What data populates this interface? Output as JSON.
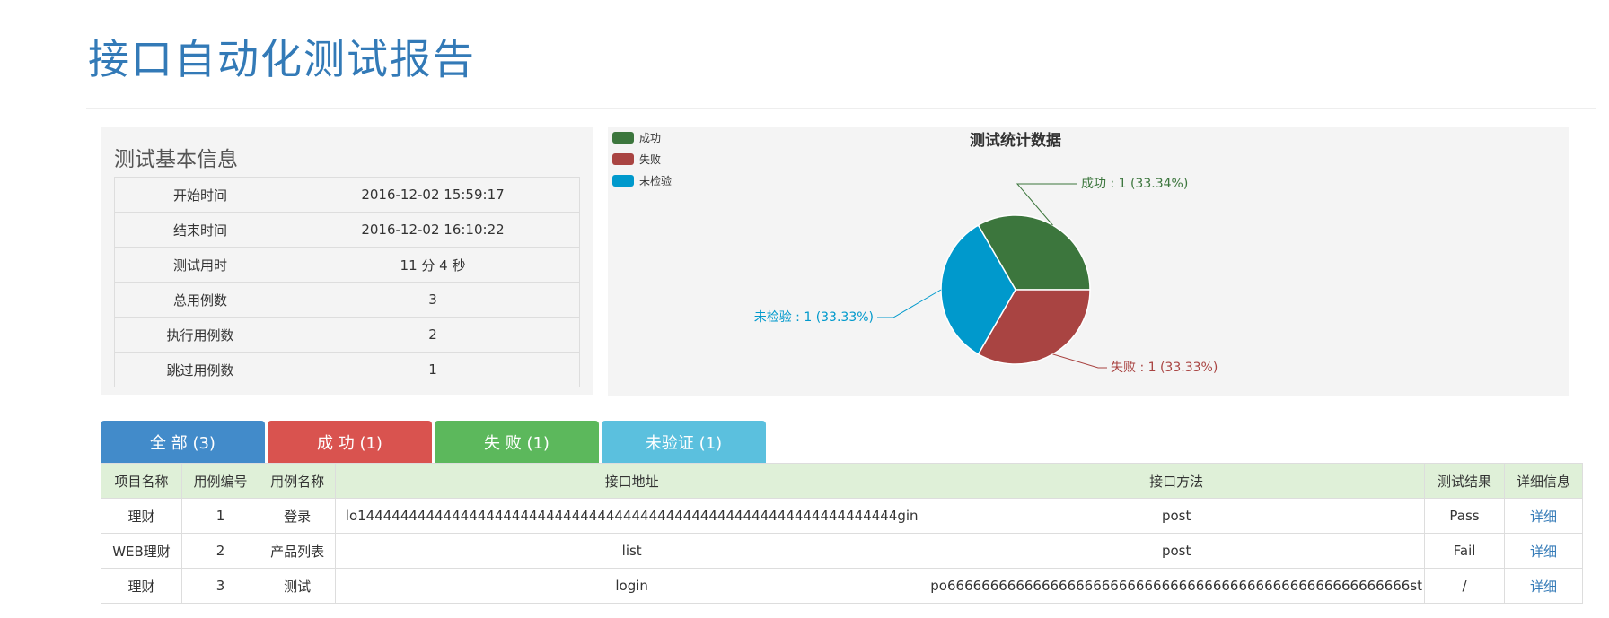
{
  "page_title": "接口自动化测试报告",
  "info": {
    "heading": "测试基本信息",
    "rows": [
      {
        "label": "开始时间",
        "value": "2016-12-02 15:59:17"
      },
      {
        "label": "结束时间",
        "value": "2016-12-02 16:10:22"
      },
      {
        "label": "测试用时",
        "value": "11 分 4 秒"
      },
      {
        "label": "总用例数",
        "value": "3"
      },
      {
        "label": "执行用例数",
        "value": "2"
      },
      {
        "label": "跳过用例数",
        "value": "1"
      }
    ]
  },
  "chart_data": {
    "type": "pie",
    "title": "测试统计数据",
    "legend_position": "top-left",
    "slices": [
      {
        "name": "成功",
        "value": 1,
        "percent": 33.34,
        "color": "#3c763d",
        "label": "成功 : 1 (33.34%)"
      },
      {
        "name": "失败",
        "value": 1,
        "percent": 33.33,
        "color": "#a94442",
        "label": "失败 : 1 (33.33%)"
      },
      {
        "name": "未检验",
        "value": 1,
        "percent": 33.33,
        "color": "#0099cc",
        "label": "未检验 : 1 (33.33%)"
      }
    ]
  },
  "tabs": [
    {
      "label": "全 部 (3)",
      "color": "#428bca"
    },
    {
      "label": "成 功 (1)",
      "color": "#d9534f"
    },
    {
      "label": "失 败 (1)",
      "color": "#5cb85c"
    },
    {
      "label": "未验证 (1)",
      "color": "#5bc0de"
    }
  ],
  "results": {
    "headers": [
      "项目名称",
      "用例编号",
      "用例名称",
      "接口地址",
      "接口方法",
      "测试结果",
      "详细信息"
    ],
    "rows": [
      [
        "理财",
        "1",
        "登录",
        "lo144444444444444444444444444444444444444444444444444444444444444gin",
        "post",
        "Pass",
        "详细"
      ],
      [
        "WEB理财",
        "2",
        "产品列表",
        "list",
        "post",
        "Fail",
        "详细"
      ],
      [
        "理财",
        "3",
        "测试",
        "login",
        "po666666666666666666666666666666666666666666666666666666st",
        "/",
        "详细"
      ]
    ]
  }
}
